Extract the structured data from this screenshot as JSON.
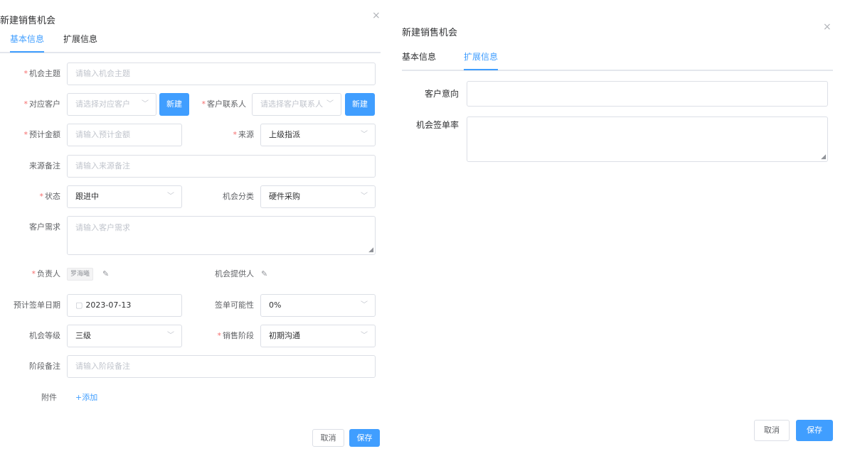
{
  "left": {
    "title": "新建销售机会",
    "close": "×",
    "tabs": [
      "基本信息",
      "扩展信息"
    ],
    "fields": {
      "subject": {
        "label": "机会主题",
        "placeholder": "请输入机会主题"
      },
      "customer": {
        "label": "对应客户",
        "placeholder": "请选择对应客户",
        "button": "新建"
      },
      "contact": {
        "label": "客户联系人",
        "placeholder": "请选择客户联系人",
        "button": "新建"
      },
      "amount": {
        "label": "预计金额",
        "placeholder": "请输入预计金额"
      },
      "source": {
        "label": "来源",
        "value": "上级指派"
      },
      "source_note": {
        "label": "来源备注",
        "placeholder": "请输入来源备注"
      },
      "status": {
        "label": "状态",
        "value": "跟进中"
      },
      "category": {
        "label": "机会分类",
        "value": "硬件采购"
      },
      "demand": {
        "label": "客户需求",
        "placeholder": "请输入客户需求"
      },
      "owner": {
        "label": "负责人",
        "value": "罗海曦"
      },
      "provider": {
        "label": "机会提供人"
      },
      "sign_date": {
        "label": "预计签单日期",
        "value": "2023-07-13"
      },
      "probability": {
        "label": "签单可能性",
        "value": "0%"
      },
      "level": {
        "label": "机会等级",
        "value": "三级"
      },
      "stage": {
        "label": "销售阶段",
        "value": "初期沟通"
      },
      "stage_note": {
        "label": "阶段备注",
        "placeholder": "请输入阶段备注"
      },
      "attachment": {
        "label": "附件",
        "link": "+添加"
      }
    },
    "cancel": "取消",
    "save": "保存"
  },
  "right": {
    "title": "新建销售机会",
    "close": "×",
    "tabs": [
      "基本信息",
      "扩展信息"
    ],
    "fields": {
      "intent": {
        "label": "客户意向"
      },
      "sign_rate": {
        "label": "机会签单率"
      }
    },
    "cancel": "取消",
    "save": "保存"
  },
  "colors": {
    "primary": "#409eff",
    "required": "#f56c6c",
    "border": "#dcdfe6",
    "placeholder": "#c0c4cc"
  },
  "icons": {
    "close": "close-icon",
    "arrow": "chevron-down-icon",
    "edit": "pencil-icon",
    "calendar": "calendar-icon",
    "resize": "resize-handle-icon"
  }
}
